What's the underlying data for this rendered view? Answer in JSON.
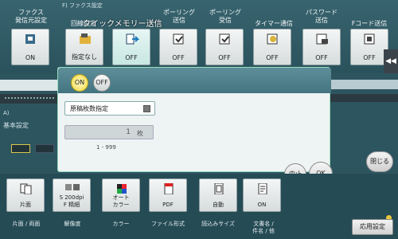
{
  "header": {
    "section_label": "F) ファクス設定",
    "dialog_title": "クイックメモリー送信"
  },
  "function_buttons": [
    {
      "title": "ファクス\n発信元設定",
      "label": "ON"
    },
    {
      "title": "回線設定",
      "label": "指定なし"
    },
    {
      "title": "",
      "label": "OFF"
    },
    {
      "title": "ポーリング\n送信",
      "label": "OFF"
    },
    {
      "title": "ポーリング\n受信",
      "label": "OFF"
    },
    {
      "title": "タイマー通信",
      "label": "OFF"
    },
    {
      "title": "パスワード\n送信",
      "label": "OFF"
    },
    {
      "title": "Fコード送信",
      "label": "OFF"
    }
  ],
  "left_panel": {
    "label_a": "A)",
    "label_base": "基本設定"
  },
  "dialog": {
    "toggle_on": "ON",
    "toggle_off": "OFF",
    "checkbox_label": "原稿枚数指定",
    "number_value": "1",
    "number_unit": "枚",
    "range": "1 - 999"
  },
  "buttons": {
    "stop": "中止",
    "ok": "OK",
    "close": "閉じる",
    "apply": "応用設定"
  },
  "bottom_buttons": [
    {
      "label": "片面",
      "caption": "片面 / 両面"
    },
    {
      "label": "S 200dpi\nF 精細",
      "caption": "解像度"
    },
    {
      "label": "オート\nカラー",
      "caption": "カラー"
    },
    {
      "label": "PDF",
      "caption": "ファイル形式"
    },
    {
      "label": "自動",
      "caption": "読込みサイズ"
    },
    {
      "label": "ON",
      "caption": "文書名 /\n件名 / 他"
    }
  ],
  "colors": {
    "accent_yellow": "#f1da3e",
    "dialog_header": "#4f828d",
    "background": "#2d5560"
  },
  "icons": [
    "fax-line-icon",
    "send-icon",
    "polling-send-icon",
    "polling-receive-icon",
    "timer-icon",
    "password-icon",
    "fcode-icon",
    "duplex-icon",
    "resolution-icon",
    "color-icon",
    "pdf-icon",
    "scan-size-icon",
    "document-name-icon",
    "chevron-left-icon"
  ]
}
